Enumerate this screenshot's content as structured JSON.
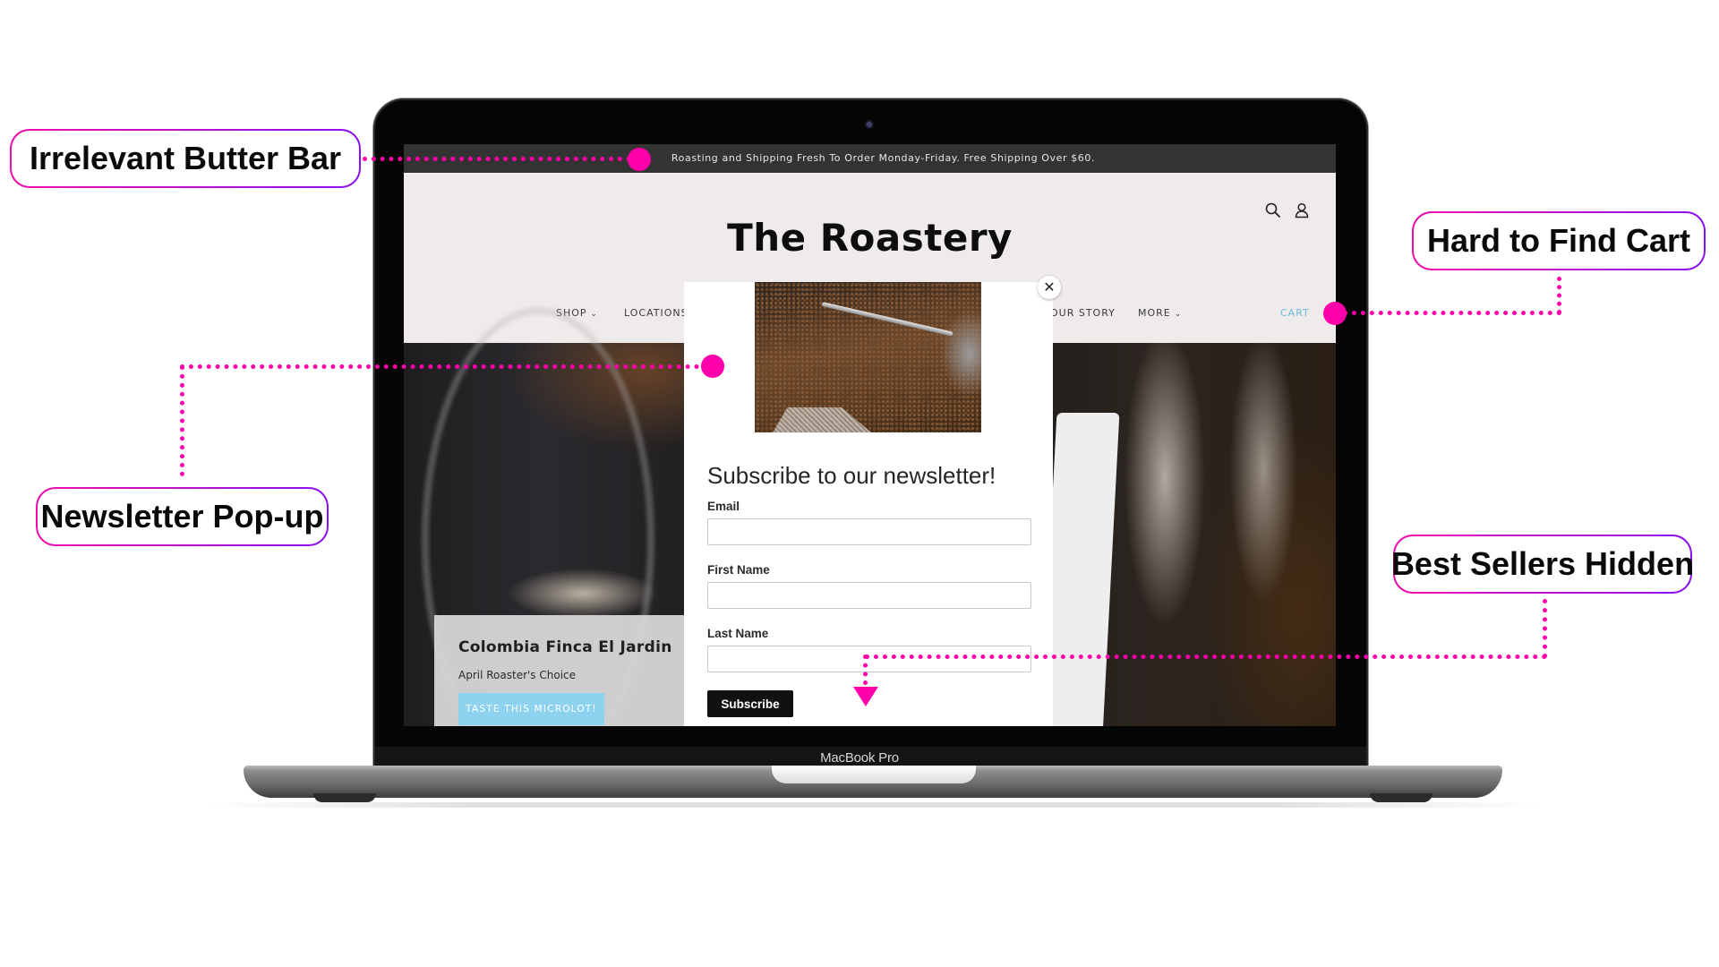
{
  "device": {
    "label": "MacBook Pro"
  },
  "website": {
    "butter_bar": "Roasting and Shipping Fresh To Order Monday-Friday. Free Shipping Over $60.",
    "logo": "The Roastery",
    "header_icons": [
      "search-icon",
      "account-icon"
    ],
    "nav": {
      "items": [
        {
          "label": "SHOP",
          "has_dropdown": true
        },
        {
          "label": "LOCATIONS",
          "has_dropdown": false
        },
        {
          "label": "OUR STORY",
          "has_dropdown": false
        },
        {
          "label": "MORE",
          "has_dropdown": true
        }
      ],
      "chevron": "⌄",
      "cart_label": "CART"
    },
    "hero": {
      "title": "Colombia Finca El Jardin",
      "subtitle": "April Roaster's Choice",
      "cta_label": "TASTE THIS MICROLOT!"
    },
    "popup": {
      "close_glyph": "✕",
      "heading": "Subscribe to our newsletter!",
      "fields": [
        {
          "label": "Email",
          "value": ""
        },
        {
          "label": "First Name",
          "value": ""
        },
        {
          "label": "Last Name",
          "value": ""
        }
      ],
      "submit_label": "Subscribe"
    }
  },
  "annotations": {
    "accent_color": "#ff00aa",
    "gradient": [
      "#f00caa",
      "#8a10f0"
    ],
    "callouts": [
      {
        "label": "Irrelevant Butter Bar"
      },
      {
        "label": "Hard to Find Cart"
      },
      {
        "label": "Newsletter Pop-up"
      },
      {
        "label": "Best Sellers Hidden"
      }
    ]
  }
}
